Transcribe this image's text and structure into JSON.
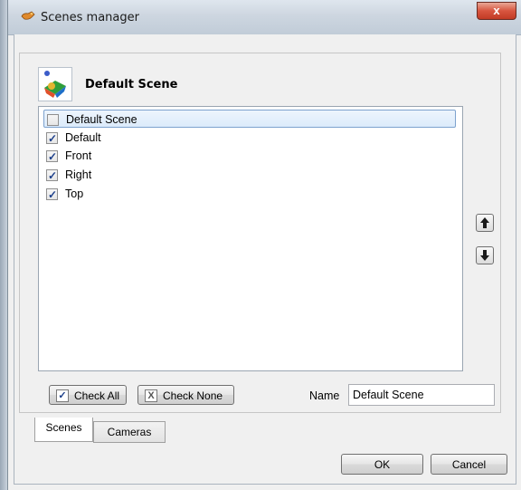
{
  "window": {
    "title": "Scenes manager",
    "close_label": "x",
    "icon": "puzzle-icon"
  },
  "header": {
    "title": "Default Scene",
    "icon": "scene-3d-icon"
  },
  "list": {
    "items": [
      {
        "label": "Default Scene",
        "checked": false,
        "selected": true
      },
      {
        "label": "Default",
        "checked": true,
        "selected": false
      },
      {
        "label": "Front",
        "checked": true,
        "selected": false
      },
      {
        "label": "Right",
        "checked": true,
        "selected": false
      },
      {
        "label": "Top",
        "checked": true,
        "selected": false
      }
    ]
  },
  "side_buttons": {
    "move_up": "up-arrow-icon",
    "move_down": "down-arrow-icon"
  },
  "actions": {
    "check_all_label": "Check All",
    "check_none_label": "Check None"
  },
  "name_field": {
    "label": "Name",
    "value": "Default Scene"
  },
  "tabs": [
    {
      "label": "Scenes",
      "active": true
    },
    {
      "label": "Cameras",
      "active": false
    }
  ],
  "footer": {
    "ok_label": "OK",
    "cancel_label": "Cancel"
  },
  "colors": {
    "selection_border": "#7da2ce",
    "close_button": "#d8553f"
  }
}
